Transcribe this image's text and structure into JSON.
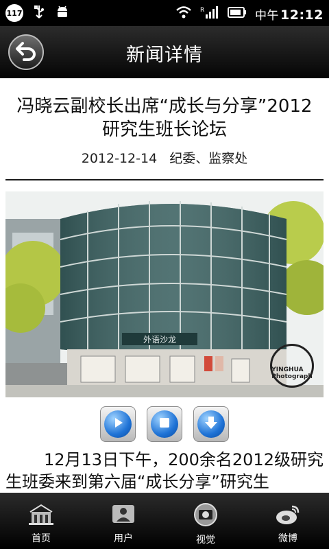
{
  "status_bar": {
    "notification_count": "117",
    "time_period": "中午",
    "time": "12:12"
  },
  "header": {
    "title": "新闻详情"
  },
  "article": {
    "title": "冯晓云副校长出席“成长与分享”2012研究生班长论坛",
    "date": "2012-12-14",
    "department": "纪委、监察处",
    "image_sign_text": "外语沙龙",
    "watermark_text": "YINGHUA Photograph",
    "body": "12月13日下午，200余名2012级研究生班委来到第六届“成长分享”研究生"
  },
  "player": {
    "play_icon": "play-icon",
    "stop_icon": "stop-icon",
    "download_icon": "download-icon"
  },
  "tabs": [
    {
      "label": "首页",
      "icon": "home-gate-icon"
    },
    {
      "label": "用户",
      "icon": "user-icon"
    },
    {
      "label": "视觉",
      "icon": "camera-icon"
    },
    {
      "label": "微博",
      "icon": "weibo-icon"
    }
  ],
  "colors": {
    "header_bg": "#000000",
    "player_blue": "#1f73d6",
    "tabbar_bg": "#1a1a1a"
  }
}
